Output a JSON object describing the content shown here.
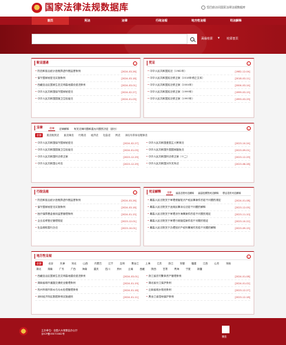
{
  "header": {
    "site_title": "国家法律法规数据库",
    "notice": "您目前访问国家法律法规数据库"
  },
  "nav": {
    "items": [
      "首页",
      "宪法",
      "法律",
      "行政法规",
      "地方性法规",
      "司法解释"
    ]
  },
  "search": {
    "placeholder": "",
    "advanced_label": "高级检索",
    "home_label": "检索首页"
  },
  "latest": {
    "title": "新法速递",
    "rows": [
      {
        "t": "防范和惩治统计造假弄虚作假监督条例",
        "d": "[2024-03-26]"
      },
      {
        "t": "保守国家秘密法实施条例",
        "d": "[2024-03-18]"
      },
      {
        "t": "西藏自治区国家生态文明高地建设促进条例",
        "d": "[2024-03-01]"
      },
      {
        "t": "中华人民共和国保守国家秘密法",
        "d": "[2024-02-27]"
      },
      {
        "t": "中华人民共和国国境卫生检疫法",
        "d": "[2024-01-03]"
      }
    ]
  },
  "constitution": {
    "title": "宪法",
    "rows": [
      {
        "t": "中华人民共和国宪法（1982年）",
        "d": "[1982-12-04]"
      },
      {
        "t": "中华人民共和国宪法修正案（2018年修正文本）",
        "d": "[2018-03-11]"
      },
      {
        "t": "中华人民共和国宪法修正案（2004年）",
        "d": "[2004-03-14]"
      },
      {
        "t": "中华人民共和国宪法修正案（1999年）",
        "d": "[1999-03-15]"
      },
      {
        "t": "中华人民共和国宪法修正案（1993年）",
        "d": "[1993-03-29]"
      }
    ]
  },
  "laws": {
    "title": "法律",
    "tabs": [
      "法律",
      "法律解释",
      "有关法律问题和重大问题的决定（部分）"
    ],
    "categories": [
      "全部",
      "宪法相关法",
      "民法商法",
      "行政法",
      "经济法",
      "社会法",
      "刑法",
      "诉讼与非诉讼程序法"
    ],
    "left": [
      {
        "t": "中华人民共和国保守国家秘密法",
        "d": "[2024-02-27]"
      },
      {
        "t": "中华人民共和国国境卫生检疫法",
        "d": "[2024-01-03]"
      },
      {
        "t": "中华人民共和国刑法修正案",
        "d": "[2023-12-29]"
      },
      {
        "t": "中华人民共和国公司法",
        "d": "[2023-12-29]"
      }
    ],
    "right": [
      {
        "t": "中华人民共和国爱国主义教育法",
        "d": "[2023-10-24]"
      },
      {
        "t": "中华人民共和国外国国家豁免法",
        "d": "[2023-09-01]"
      },
      {
        "t": "中华人民共和国刑法修正案（十二）",
        "d": "[2023-12-29]"
      },
      {
        "t": "中华人民共和国对外关系法",
        "d": "[2023-06-28]"
      }
    ]
  },
  "admin": {
    "title": "行政法规",
    "rows": [
      {
        "t": "防范和惩治统计造假弄虚作假监督条例",
        "d": "[2024-03-26]"
      },
      {
        "t": "保守国家秘密法实施条例",
        "d": "[2024-03-18]"
      },
      {
        "t": "医疗保障基金使用监督管理条例",
        "d": "[2024-01-15]"
      },
      {
        "t": "企业名称登记管理规定",
        "d": "[2023-12-01]"
      },
      {
        "t": "社会救助暂行办法",
        "d": "[2023-10-01]"
      }
    ]
  },
  "judicial": {
    "title": "司法解释",
    "tabs": [
      "全部",
      "最高法院司法解释",
      "最高检察院司法解释",
      "联合发布司法解释"
    ],
    "rows": [
      {
        "t": "最高人民法院关于审理侵害知识产权民事案件的若干问题的规定",
        "d": "[2024-01-08]"
      },
      {
        "t": "最高人民法院关于适用民事诉讼法若干问题的解释",
        "d": "[2023-12-05]"
      },
      {
        "t": "最高人民法院关于审理涉外海事案件的若干问题的规定",
        "d": "[2023-11-10]"
      },
      {
        "t": "最高人民法院关于审理行政赔偿案件若干问题的规定",
        "d": "[2023-10-22]"
      },
      {
        "t": "最高人民法院关于办理知识产权刑事案件的若干问题的解释",
        "d": "[2023-09-15]"
      }
    ]
  },
  "local": {
    "title": "地方性法规",
    "regions_row1": [
      "全部",
      "北京",
      "天津",
      "河北",
      "山西",
      "内蒙古",
      "辽宁",
      "吉林",
      "黑龙江",
      "上海",
      "江苏",
      "浙江",
      "安徽",
      "福建",
      "江西",
      "山东",
      "河南"
    ],
    "regions_row2": [
      "湖北",
      "湖南",
      "广东",
      "广西",
      "海南",
      "重庆",
      "四川",
      "贵州",
      "云南",
      "西藏",
      "陕西",
      "甘肃",
      "青海",
      "宁夏",
      "新疆"
    ],
    "left": [
      {
        "t": "西藏自治区国家生态文明高地建设促进条例",
        "d": "[2024-03-01]"
      },
      {
        "t": "湖南省城市道路交通安全管理条例",
        "d": "[2024-01-19]"
      },
      {
        "t": "杭州市城市排水与污水处理管理条例",
        "d": "[2024-01-18]"
      },
      {
        "t": "深圳经济特区数据条例实施细则",
        "d": "[2024-01-11]"
      }
    ],
    "right": [
      {
        "t": "浙江省农村集体资产管理条例",
        "d": "[2024-01-08]"
      },
      {
        "t": "湖北省长江保护条例",
        "d": "[2024-01-02]"
      },
      {
        "t": "云南省城乡规划条例",
        "d": "[2023-12-27]"
      },
      {
        "t": "黑龙江省湿地保护条例",
        "d": "[2023-12-18]"
      }
    ]
  },
  "footer": {
    "line1": "主办单位：全国人大常委会办公厅",
    "line2": "京ICP备05070082号",
    "qr_label": "微信"
  }
}
